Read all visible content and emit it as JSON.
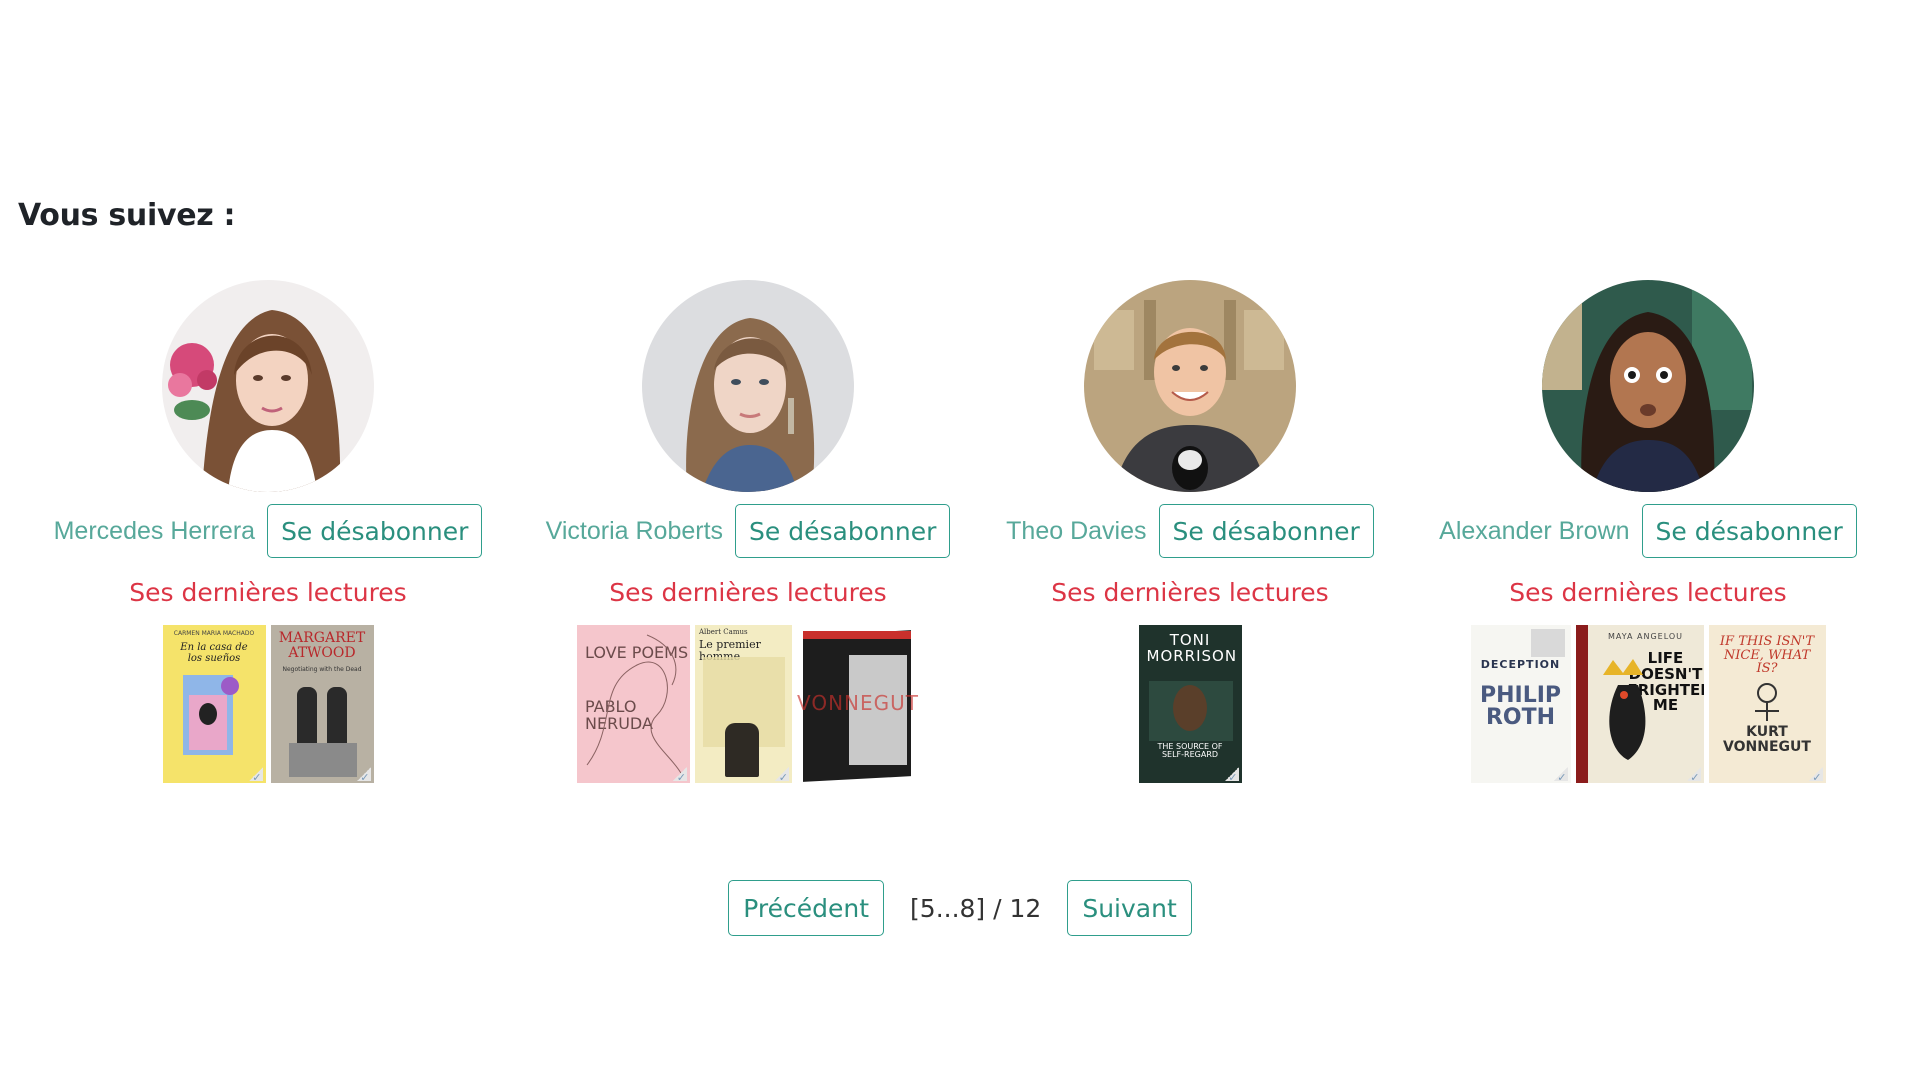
{
  "section_title": "Vous suivez :",
  "unsubscribe_label": "Se désabonner",
  "readings_label": "Ses dernières lectures",
  "users": [
    {
      "name": "Mercedes Herrera",
      "books": [
        {
          "author": "CARMEN MARIA MACHADO",
          "title": "En la casa de los sueños"
        },
        {
          "author": "MARGARET ATWOOD",
          "title": "Negotiating with the Dead"
        }
      ]
    },
    {
      "name": "Victoria Roberts",
      "books": [
        {
          "author": "PABLO NERUDA",
          "title": "LOVE POEMS"
        },
        {
          "author": "Albert Camus",
          "title": "Le premier homme"
        },
        {
          "author": "",
          "title": "VONNEGUT"
        }
      ]
    },
    {
      "name": "Theo Davies",
      "books": [
        {
          "author": "TONI MORRISON",
          "title": "THE SOURCE OF SELF-REGARD"
        }
      ]
    },
    {
      "name": "Alexander Brown",
      "books": [
        {
          "author": "PHILIP ROTH",
          "title": "DECEPTION"
        },
        {
          "author": "MAYA ANGELOU",
          "title": "LIFE DOESN'T FRIGHTEN ME"
        },
        {
          "author": "KURT VONNEGUT",
          "title": "IF THIS ISN'T NICE, WHAT IS?"
        }
      ]
    }
  ],
  "pagination": {
    "prev_label": "Précédent",
    "info": "[5...8] / 12",
    "next_label": "Suivant"
  },
  "colors": {
    "accent": "#2a8f7e",
    "name": "#57a89a",
    "readings": "#dc3545"
  }
}
